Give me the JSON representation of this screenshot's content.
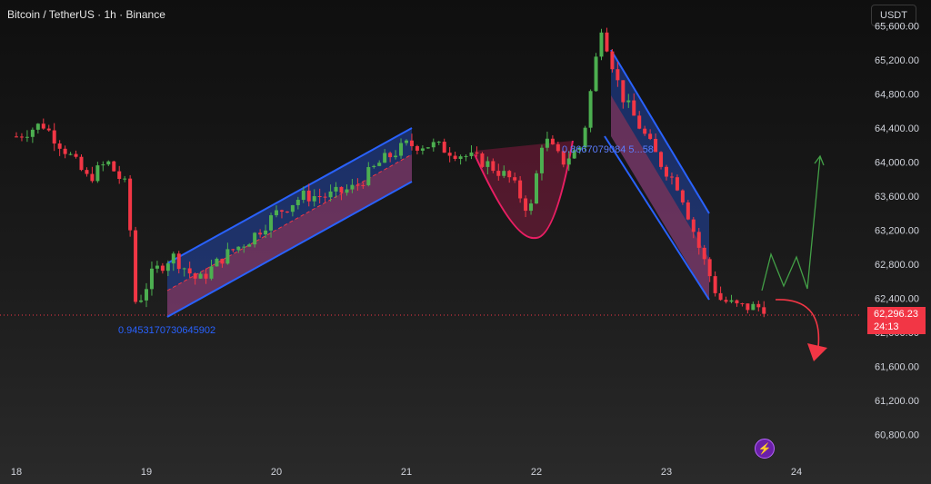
{
  "header": {
    "title": "Bitcoin / TetherUS · 1h · Binance",
    "currency_label": "USDT"
  },
  "price_tag": {
    "price": "62,296.23",
    "countdown": "24:13"
  },
  "annotations": {
    "left_channel_label": "0.9453170730645902",
    "top_label": "0.8667079084 5...58"
  },
  "colors": {
    "up": "#26a69a",
    "down": "#f23645",
    "up_candle": "#4caf50",
    "channel_blue": "#2962ff",
    "cup_pink": "#e91e63"
  },
  "icons": {
    "flash": "lightning-icon"
  },
  "chart_data": {
    "type": "candlestick",
    "title": "Bitcoin / TetherUS · 1h · Binance",
    "xlabel": "",
    "ylabel": "",
    "x_ticks": [
      "18",
      "19",
      "20",
      "21",
      "22",
      "23",
      "24"
    ],
    "y_ticks": [
      60800,
      61200,
      61600,
      62000,
      62400,
      62800,
      63200,
      63600,
      64000,
      64400,
      64800,
      65200,
      65600
    ],
    "ylim": [
      60680,
      65710
    ],
    "current_price": 62296.23,
    "close_series": [
      {
        "day": 18.0,
        "close": 64300
      },
      {
        "day": 18.2,
        "close": 64450
      },
      {
        "day": 18.4,
        "close": 64100
      },
      {
        "day": 18.55,
        "close": 63800
      },
      {
        "day": 18.7,
        "close": 64000
      },
      {
        "day": 18.85,
        "close": 63700
      },
      {
        "day": 18.92,
        "close": 62300
      },
      {
        "day": 19.05,
        "close": 62700
      },
      {
        "day": 19.2,
        "close": 62900
      },
      {
        "day": 19.4,
        "close": 62600
      },
      {
        "day": 19.6,
        "close": 62900
      },
      {
        "day": 19.8,
        "close": 63100
      },
      {
        "day": 20.0,
        "close": 63400
      },
      {
        "day": 20.2,
        "close": 63600
      },
      {
        "day": 20.4,
        "close": 63600
      },
      {
        "day": 20.6,
        "close": 63700
      },
      {
        "day": 20.8,
        "close": 64000
      },
      {
        "day": 21.0,
        "close": 64200
      },
      {
        "day": 21.2,
        "close": 64200
      },
      {
        "day": 21.4,
        "close": 64100
      },
      {
        "day": 21.6,
        "close": 64000
      },
      {
        "day": 21.8,
        "close": 63800
      },
      {
        "day": 21.95,
        "close": 63400
      },
      {
        "day": 22.05,
        "close": 64300
      },
      {
        "day": 22.2,
        "close": 64000
      },
      {
        "day": 22.35,
        "close": 64200
      },
      {
        "day": 22.5,
        "close": 65600
      },
      {
        "day": 22.65,
        "close": 64800
      },
      {
        "day": 22.8,
        "close": 64400
      },
      {
        "day": 22.95,
        "close": 64000
      },
      {
        "day": 23.1,
        "close": 63700
      },
      {
        "day": 23.25,
        "close": 63000
      },
      {
        "day": 23.4,
        "close": 62400
      },
      {
        "day": 23.55,
        "close": 62300
      },
      {
        "day": 23.75,
        "close": 62296
      }
    ]
  }
}
